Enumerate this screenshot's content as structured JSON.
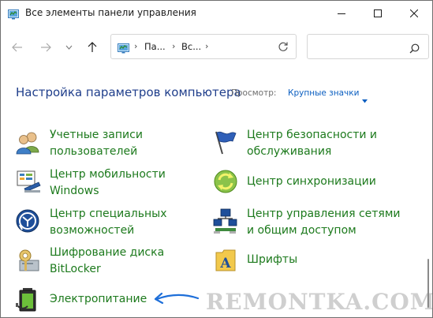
{
  "window": {
    "title": "Все элементы панели управления",
    "controls": {
      "minimize": "minimize-icon",
      "maximize": "maximize-icon",
      "close": "close-icon"
    }
  },
  "navigation": {
    "breadcrumbs": [
      "Па...",
      "Вс..."
    ],
    "search_placeholder": ""
  },
  "header": {
    "title": "Настройка параметров компьютера",
    "view_label": "Просмотр:",
    "view_value": "Крупные значки"
  },
  "items": [
    {
      "label": "Учетные записи пользователей",
      "icon": "users-icon"
    },
    {
      "label": "Центр безопасности и обслуживания",
      "icon": "flag-icon"
    },
    {
      "label": "Центр мобильности Windows",
      "icon": "mobility-icon"
    },
    {
      "label": "Центр синхронизации",
      "icon": "sync-icon"
    },
    {
      "label": "Центр специальных возможностей",
      "icon": "accessibility-icon"
    },
    {
      "label": "Центр управления сетями и общим доступом",
      "icon": "network-icon"
    },
    {
      "label": "Шифрование диска BitLocker",
      "icon": "bitlocker-icon"
    },
    {
      "label": "Шрифты",
      "icon": "fonts-icon"
    },
    {
      "label": "Электропитание",
      "icon": "battery-icon"
    }
  ],
  "watermark": "REMONTKA.COM",
  "colors": {
    "link_green": "#1d7a1d",
    "title_blue": "#1f3e8b",
    "view_blue": "#0a5ec0",
    "annotation_blue": "#1e6fd9"
  }
}
